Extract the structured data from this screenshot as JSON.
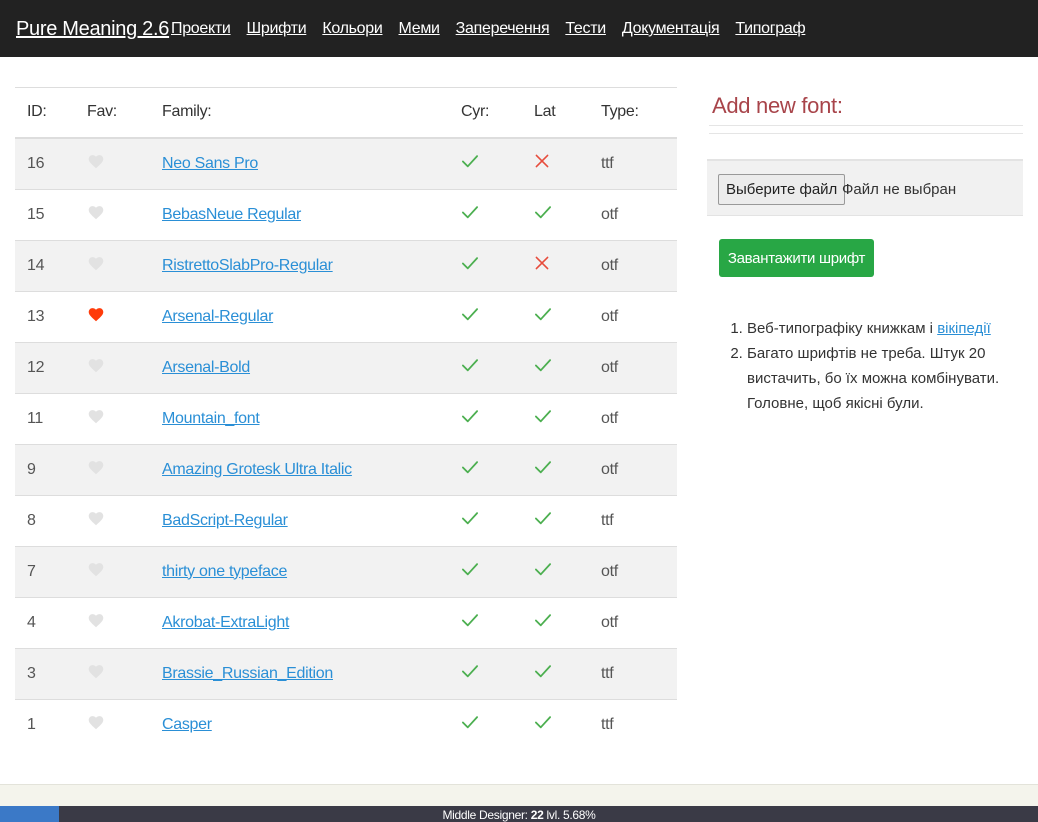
{
  "navbar": {
    "brand": "Pure Meaning 2.6",
    "links": [
      "Проекти",
      "Шрифти",
      "Кольори",
      "Меми",
      "Заперечення",
      "Тести",
      "Документація",
      "Типограф"
    ]
  },
  "table": {
    "headers": {
      "id": "ID:",
      "fav": "Fav:",
      "family": "Family:",
      "cyr": "Cyr:",
      "lat": "Lat",
      "type": "Type:"
    },
    "rows": [
      {
        "id": "16",
        "fav": false,
        "family": "Neo Sans Pro",
        "cyr": true,
        "lat": false,
        "type": "ttf"
      },
      {
        "id": "15",
        "fav": false,
        "family": "BebasNeue Regular",
        "cyr": true,
        "lat": true,
        "type": "otf"
      },
      {
        "id": "14",
        "fav": false,
        "family": "RistrettoSlabPro-Regular",
        "cyr": true,
        "lat": false,
        "type": "otf"
      },
      {
        "id": "13",
        "fav": true,
        "family": "Arsenal-Regular",
        "cyr": true,
        "lat": true,
        "type": "otf"
      },
      {
        "id": "12",
        "fav": false,
        "family": "Arsenal-Bold",
        "cyr": true,
        "lat": true,
        "type": "otf"
      },
      {
        "id": "11",
        "fav": false,
        "family": "Mountain_font",
        "cyr": true,
        "lat": true,
        "type": "otf"
      },
      {
        "id": "9",
        "fav": false,
        "family": "Amazing Grotesk Ultra Italic",
        "cyr": true,
        "lat": true,
        "type": "otf"
      },
      {
        "id": "8",
        "fav": false,
        "family": "BadScript-Regular",
        "cyr": true,
        "lat": true,
        "type": "ttf"
      },
      {
        "id": "7",
        "fav": false,
        "family": "thirty one typeface",
        "cyr": true,
        "lat": true,
        "type": "otf"
      },
      {
        "id": "4",
        "fav": false,
        "family": "Akrobat-ExtraLight",
        "cyr": true,
        "lat": true,
        "type": "otf"
      },
      {
        "id": "3",
        "fav": false,
        "family": "Brassie_Russian_Edition",
        "cyr": true,
        "lat": true,
        "type": "ttf"
      },
      {
        "id": "1",
        "fav": false,
        "family": "Casper",
        "cyr": true,
        "lat": true,
        "type": "ttf"
      }
    ]
  },
  "sidebar": {
    "title": "Add new font:",
    "file_button": "Выберите файл",
    "file_status": "Файл не выбран",
    "upload_button": "Завантажити шрифт",
    "note1_text": "Веб-типографіку книжкам і ",
    "note1_link": "вікіпедії",
    "note2_text": "Багато шрифтів не треба. Штук 20 вистачить, бо їх можна комбінувати. Головне, щоб якісні були."
  },
  "status": {
    "prefix": "Middle Designer: ",
    "level": "22",
    "suffix": " lvl. 5.68%"
  },
  "colors": {
    "navbar": "#222222",
    "link": "#2a8fd6",
    "check": "#4caf50",
    "cross": "#e74c3c",
    "heart_on": "#ff3b0a",
    "heart_off": "#e2e2e2",
    "upload_button": "#28a745",
    "sidebar_title": "#a8444a"
  }
}
